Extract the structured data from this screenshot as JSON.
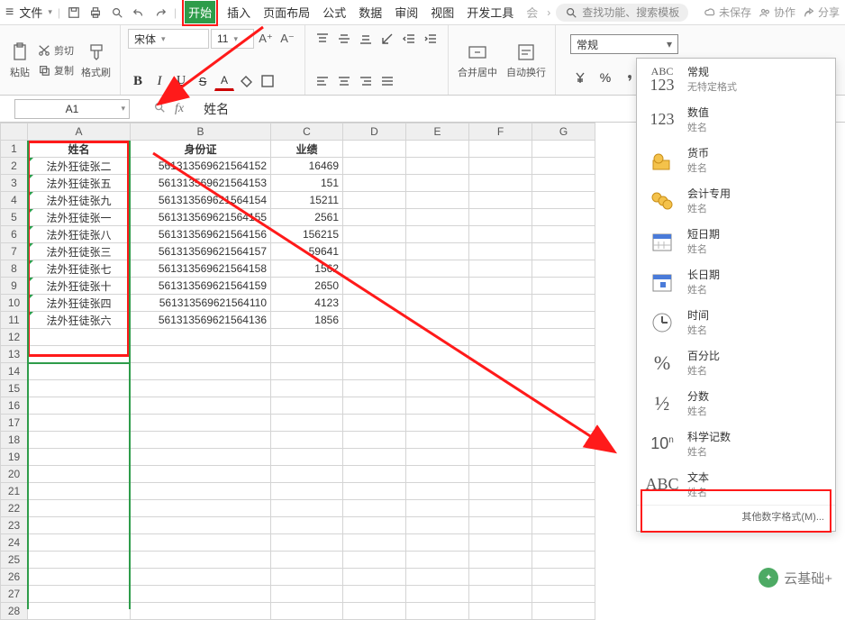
{
  "menubar": {
    "file": "文件",
    "tabs": [
      "开始",
      "插入",
      "页面布局",
      "公式",
      "数据",
      "审阅",
      "视图",
      "开发工具",
      "会"
    ],
    "search_placeholder": "查找功能、搜索模板",
    "unsaved": "未保存",
    "collab": "协作",
    "share": "分享"
  },
  "ribbon": {
    "paste": "粘贴",
    "cut": "剪切",
    "copy": "复制",
    "fmtpaint": "格式刷",
    "font_name": "宋体",
    "font_size": "11",
    "merge": "合并居中",
    "wrap": "自动换行",
    "numfmt_label": "常规"
  },
  "fx": {
    "namebox": "A1",
    "fx": "fx",
    "formula": "姓名"
  },
  "columns": [
    "A",
    "B",
    "C",
    "D",
    "E",
    "F",
    "G"
  ],
  "headers": {
    "a": "姓名",
    "b": "身份证",
    "c": "业绩"
  },
  "rows": [
    {
      "a": "法外狂徒张二",
      "b": "561313569621564152",
      "c": "16469"
    },
    {
      "a": "法外狂徒张五",
      "b": "561313569621564153",
      "c": "151"
    },
    {
      "a": "法外狂徒张九",
      "b": "561313569621564154",
      "c": "15211"
    },
    {
      "a": "法外狂徒张一",
      "b": "561313569621564155",
      "c": "2561"
    },
    {
      "a": "法外狂徒张八",
      "b": "561313569621564156",
      "c": "156215"
    },
    {
      "a": "法外狂徒张三",
      "b": "561313569621564157",
      "c": "59641"
    },
    {
      "a": "法外狂徒张七",
      "b": "561313569621564158",
      "c": "1562"
    },
    {
      "a": "法外狂徒张十",
      "b": "561313569621564159",
      "c": "2650"
    },
    {
      "a": "法外狂徒张四",
      "b": "561313569621564110",
      "c": "4123"
    },
    {
      "a": "法外狂徒张六",
      "b": "561313569621564136",
      "c": "1856"
    }
  ],
  "fmt": {
    "general": {
      "t": "常规",
      "s": "无特定格式"
    },
    "number": {
      "t": "数值",
      "s": "姓名"
    },
    "currency": {
      "t": "货币",
      "s": "姓名"
    },
    "account": {
      "t": "会计专用",
      "s": "姓名"
    },
    "dshort": {
      "t": "短日期",
      "s": "姓名"
    },
    "dlong": {
      "t": "长日期",
      "s": "姓名"
    },
    "time": {
      "t": "时间",
      "s": "姓名"
    },
    "percent": {
      "t": "百分比",
      "s": "姓名"
    },
    "fraction": {
      "t": "分数",
      "s": "姓名"
    },
    "sci": {
      "t": "科学记数",
      "s": "姓名"
    },
    "text": {
      "t": "文本",
      "s": "姓名"
    },
    "footer": "其他数字格式(M)...",
    "icon_general_top": "ABC",
    "icon_general_bot": "123",
    "icon_number": "123",
    "icon_percent": "%",
    "icon_fraction": "½",
    "icon_sci": "10",
    "icon_text": "ABC"
  },
  "watermark": "云基础+"
}
